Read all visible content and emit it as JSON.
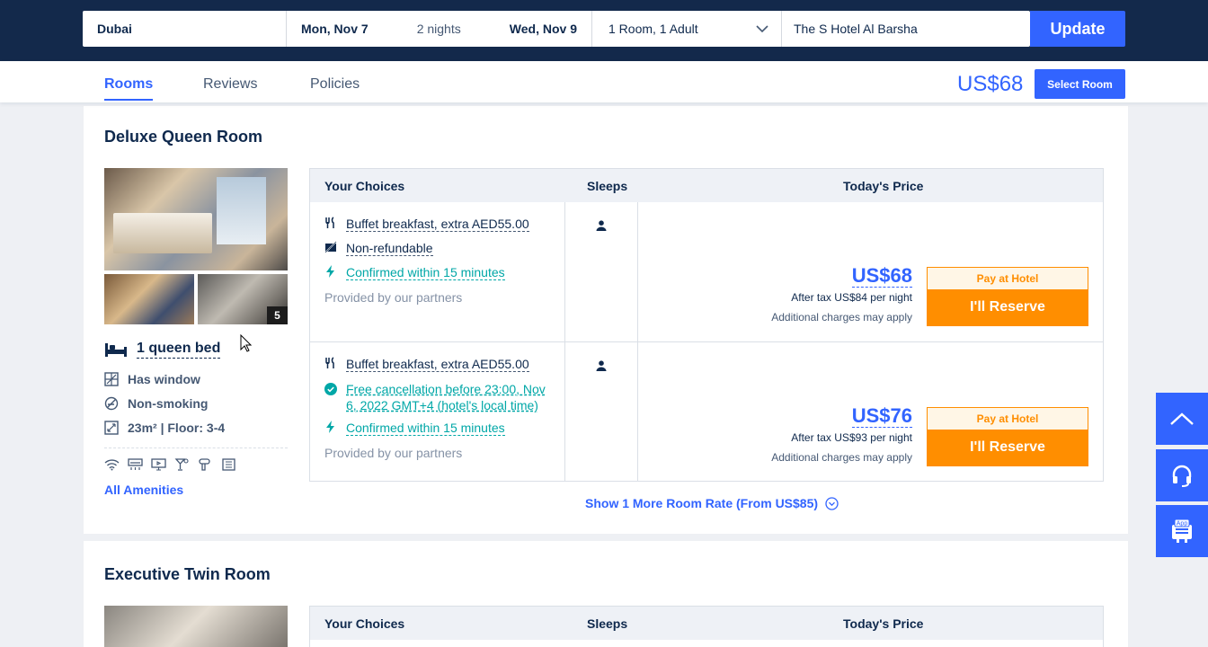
{
  "search": {
    "city": "Dubai",
    "checkin": "Mon, Nov 7",
    "nights": "2 nights",
    "checkout": "Wed, Nov 9",
    "rooms": "1 Room, 1 Adult",
    "hotel": "The S Hotel Al Barsha",
    "update_label": "Update"
  },
  "tabs": {
    "rooms": "Rooms",
    "reviews": "Reviews",
    "policies": "Policies"
  },
  "header": {
    "price": "US$68",
    "select_room_label": "Select Room"
  },
  "room1": {
    "title": "Deluxe Queen Room",
    "photo_count": "5",
    "bed": "1 queen bed",
    "features": {
      "window": "Has window",
      "smoking": "Non-smoking",
      "area": "23m² | Floor: 3-4"
    },
    "all_amenities": "All Amenities",
    "table_head": {
      "choices": "Your Choices",
      "sleeps": "Sleeps",
      "price": "Today's Price"
    },
    "rates": [
      {
        "breakfast": "Buffet breakfast, extra AED55.00",
        "cancellation": "Non-refundable",
        "confirm": "Confirmed within 15 minutes",
        "provided": "Provided by our partners",
        "price": "US$68",
        "after_tax": "After tax US$84 per night",
        "charges": "Additional charges may apply",
        "pay_label": "Pay at Hotel",
        "reserve_label": "I'll Reserve"
      },
      {
        "breakfast": "Buffet breakfast, extra AED55.00",
        "cancellation": "Free cancellation before 23:00, Nov 6, 2022 GMT+4 (hotel's local time)",
        "confirm": "Confirmed within 15 minutes",
        "provided": "Provided by our partners",
        "price": "US$76",
        "after_tax": "After tax US$93 per night",
        "charges": "Additional charges may apply",
        "pay_label": "Pay at Hotel",
        "reserve_label": "I'll Reserve"
      }
    ],
    "more_rates": "Show 1 More Room Rate (From US$85)"
  },
  "room2": {
    "title": "Executive Twin Room",
    "table_head": {
      "choices": "Your Choices",
      "sleeps": "Sleeps",
      "price": "Today's Price"
    }
  },
  "side": {
    "app_label": "App"
  },
  "colors": {
    "navy": "#13294b",
    "accent": "#3264ff",
    "orange": "#ff8e00",
    "teal": "#00a7a7"
  }
}
